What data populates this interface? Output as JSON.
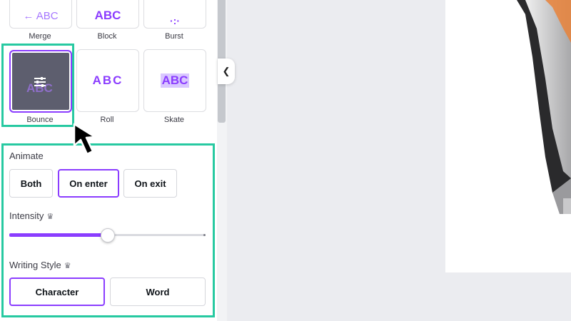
{
  "effects": {
    "top_row": [
      {
        "label": "Merge",
        "preview": "← ABC"
      },
      {
        "label": "Block",
        "preview": "ABC"
      },
      {
        "label": "Burst",
        "preview": "·:·"
      }
    ],
    "row2": [
      {
        "label": "Bounce",
        "preview": "ABC",
        "selected": true
      },
      {
        "label": "Roll",
        "preview": "ABC"
      },
      {
        "label": "Skate",
        "preview": "ABC"
      }
    ]
  },
  "animate": {
    "label": "Animate",
    "options": [
      "Both",
      "On enter",
      "On exit"
    ],
    "selected": "On enter"
  },
  "intensity": {
    "label": "Intensity",
    "value": 0.5
  },
  "writing_style": {
    "label": "Writing Style",
    "options": [
      "Character",
      "Word"
    ],
    "selected": "Character"
  },
  "icons": {
    "premium": "crown-icon",
    "collapse": "chevron-left-icon",
    "adjust": "sliders-icon"
  },
  "colors": {
    "accent": "#8b3dff",
    "highlight": "#27c9a1"
  }
}
